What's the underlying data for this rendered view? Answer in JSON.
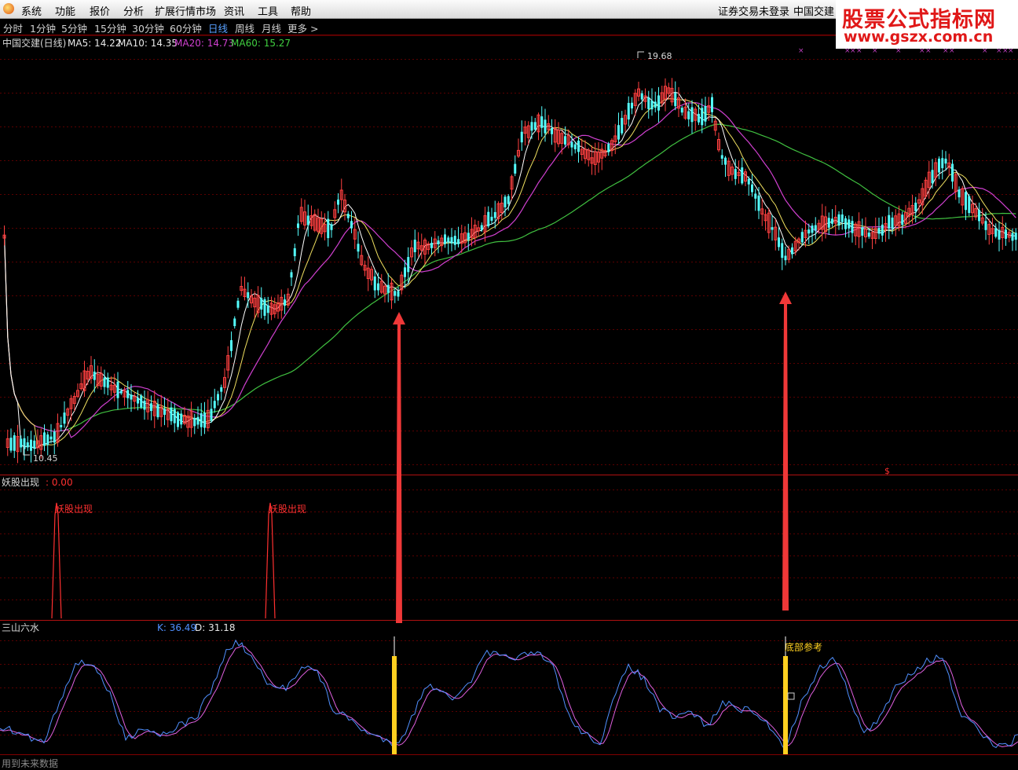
{
  "menu": {
    "items": [
      "系统",
      "功能",
      "报价",
      "分析",
      "扩展行情市场",
      "资讯",
      "工具",
      "帮助"
    ],
    "login_status": "证券交易未登录",
    "stock_name": "中国交建"
  },
  "brand": {
    "title": "股票公式指标网",
    "url": "www.gszx.com.cn"
  },
  "periods": {
    "items": [
      "分时",
      "1分钟",
      "5分钟",
      "15分钟",
      "30分钟",
      "60分钟",
      "日线",
      "周线",
      "月线",
      "更多 >"
    ],
    "active_index": 6
  },
  "price_panel": {
    "title": "中国交建(日线)",
    "indicators": [
      {
        "label": "MA5: 14.22",
        "color": "#e8e8e8"
      },
      {
        "label": "MA10: 14.35",
        "color": "#e8e8e8"
      },
      {
        "label": "MA20: 14.73",
        "color": "#d040d0"
      },
      {
        "label": "MA60: 15.27",
        "color": "#40d040"
      }
    ],
    "high_label": "19.68",
    "low_label": "10.45",
    "colors": {
      "up": "#ff4040",
      "down": "#54ffff",
      "ma5": "#ffffff",
      "ma10": "#f0e060",
      "ma20": "#d040d0",
      "ma60": "#40c040"
    }
  },
  "signal_panel": {
    "title": "妖股出现",
    "value": ": 0.00",
    "signal_label": "妖股出现",
    "color": "#ff3030"
  },
  "kd_panel": {
    "title": "三山六水",
    "k_label": "K: 36.49",
    "d_label": "D: 31.18",
    "bottom_label": "底部参考",
    "colors": {
      "k": "#5090ff",
      "d": "#e060e0",
      "bar": "#ffd020"
    }
  },
  "footer": {
    "text": "用到未来数据"
  }
}
